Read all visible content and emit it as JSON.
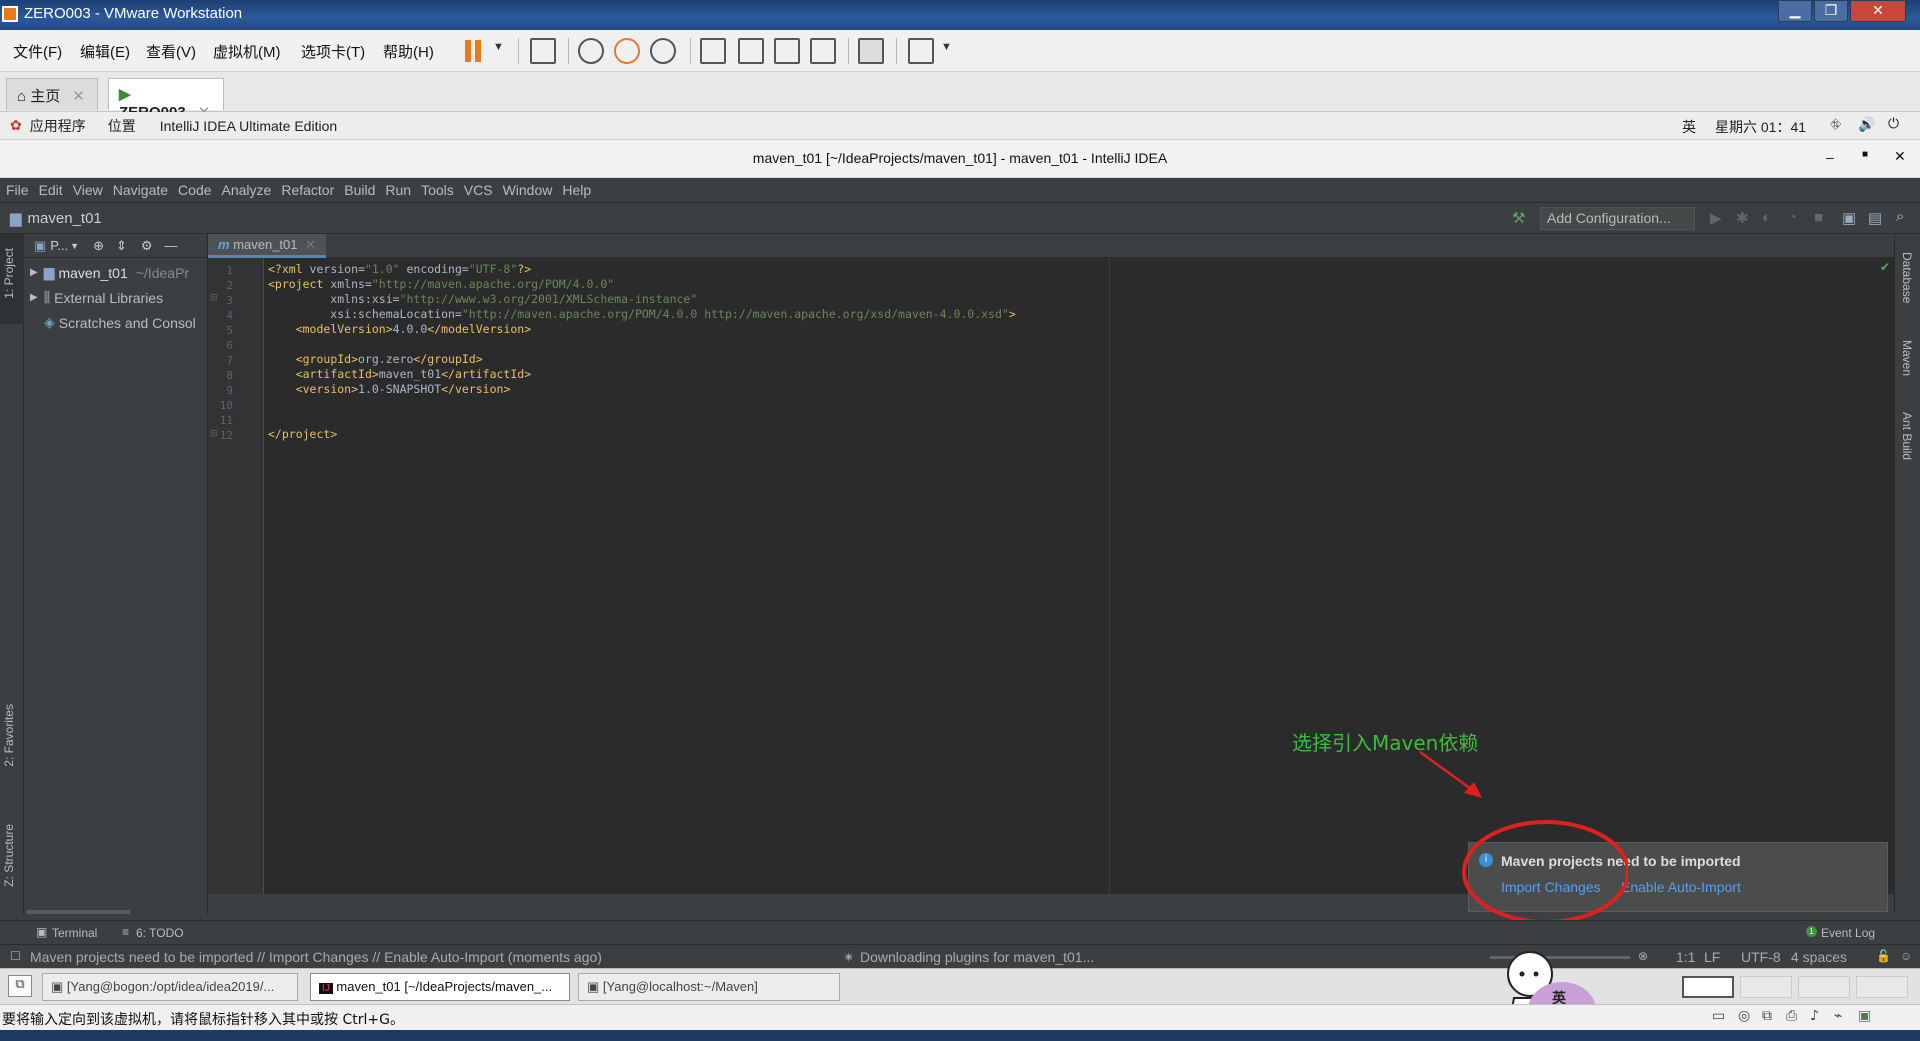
{
  "vmware": {
    "window_title": "ZERO003 - VMware Workstation",
    "menu": [
      "文件(F)",
      "编辑(E)",
      "查看(V)",
      "虚拟机(M)",
      "选项卡(T)",
      "帮助(H)"
    ],
    "tabs": [
      {
        "label": "主页"
      },
      {
        "label": "ZERO003"
      }
    ],
    "status_message": "要将输入定向到该虚拟机，请将鼠标指针移入其中或按 Ctrl+G。",
    "colors": {
      "accent": "#e87a1a",
      "title_bar": "#2b5a99"
    }
  },
  "gnome": {
    "applications": "应用程序",
    "places": "位置",
    "active_app": "IntelliJ IDEA Ultimate Edition",
    "input_method": "英",
    "clock": "星期六 01：41"
  },
  "idea": {
    "window_title": "maven_t01 [~/IdeaProjects/maven_t01] - maven_t01 - IntelliJ IDEA",
    "menu": [
      "File",
      "Edit",
      "View",
      "Navigate",
      "Code",
      "Analyze",
      "Refactor",
      "Build",
      "Run",
      "Tools",
      "VCS",
      "Window",
      "Help"
    ],
    "breadcrumb": "maven_t01",
    "run_config": "Add Configuration...",
    "project_panel": {
      "header": "P...",
      "tree": [
        {
          "label": "maven_t01",
          "suffix": "~/IdeaPr"
        },
        {
          "label": "External Libraries",
          "suffix": ""
        },
        {
          "label": "Scratches and Consol",
          "suffix": ""
        }
      ]
    },
    "left_tools": [
      "1: Project",
      "2: Favorites",
      "Z: Structure"
    ],
    "right_tools": [
      "Database",
      "Maven",
      "Ant Build"
    ],
    "editor_tab": "maven_t01",
    "editor_tab_icon": "m",
    "line_numbers": [
      "1",
      "2",
      "3",
      "4",
      "5",
      "6",
      "7",
      "8",
      "9",
      "10",
      "11",
      "12"
    ],
    "code_lines": [
      "<?xml version=\"1.0\" encoding=\"UTF-8\"?>",
      "<project xmlns=\"http://maven.apache.org/POM/4.0.0\"",
      "         xmlns:xsi=\"http://www.w3.org/2001/XMLSchema-instance\"",
      "         xsi:schemaLocation=\"http://maven.apache.org/POM/4.0.0 http://maven.apache.org/xsd/maven-4.0.0.xsd\">",
      "    <modelVersion>4.0.0</modelVersion>",
      "",
      "    <groupId>org.zero</groupId>",
      "    <artifactId>maven_t01</artifactId>",
      "    <version>1.0-SNAPSHOT</version>",
      "",
      "",
      "</project>"
    ],
    "notification": {
      "title": "Maven projects need to be imported",
      "import_link": "Import Changes",
      "auto_import_link": "Enable Auto-Import"
    },
    "annotation": "选择引入Maven依赖",
    "bottom_tools": {
      "terminal": "Terminal",
      "todo": "6: TODO",
      "event_log": "Event Log",
      "event_count": "1"
    },
    "status": {
      "message": "Maven projects need to be imported // Import Changes // Enable Auto-Import (moments ago)",
      "progress": "Downloading plugins for maven_t01...",
      "position": "1:1",
      "line_sep": "LF",
      "encoding": "UTF-8",
      "indent": "4 spaces"
    }
  },
  "taskbar": {
    "items": [
      {
        "label": "[Yang@bogon:/opt/idea/idea2019/..."
      },
      {
        "label": "maven_t01 [~/IdeaProjects/maven_..."
      },
      {
        "label": "[Yang@localhost:~/Maven]"
      }
    ],
    "ime_label": "英"
  }
}
